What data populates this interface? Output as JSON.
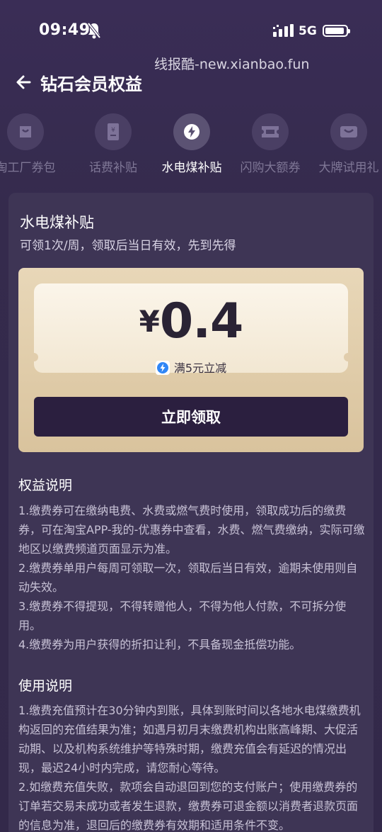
{
  "status": {
    "time": "09:49",
    "network": "5G"
  },
  "watermark": "线报酷-new.xianbao.fun",
  "header": {
    "title": "钻石会员权益"
  },
  "tabs": [
    {
      "label": "淘工厂券包",
      "icon": "bag-icon"
    },
    {
      "label": "话费补贴",
      "icon": "phone-bill-icon"
    },
    {
      "label": "水电煤补贴",
      "icon": "utility-icon",
      "active": true
    },
    {
      "label": "闪购大额券",
      "icon": "ticket-icon"
    },
    {
      "label": "大牌试用礼",
      "icon": "gift-box-icon"
    }
  ],
  "card": {
    "title": "水电煤补贴",
    "subtitle": "可领1次/周，领取后当日有效，先到先得",
    "coupon": {
      "currency": "¥",
      "amount": "0.4",
      "condition": "满5元立减"
    },
    "claim_label": "立即领取",
    "rights": {
      "title": "权益说明",
      "items": [
        "1.缴费券可在缴纳电费、水费或燃气费时使用，领取成功后的缴费券，可在淘宝APP-我的-优惠券中查看，水费、燃气费缴纳，实际可缴地区以缴费频道页面显示为准。",
        "2.缴费券单用户每周可领取一次，领取后当日有效，逾期未使用则自动失效。",
        "3.缴费券不得提现，不得转赠他人，不得为他人付款，不可拆分使用。",
        "4.缴费券为用户获得的折扣让利，不具备现金抵偿功能。"
      ]
    },
    "usage": {
      "title": "使用说明",
      "items": [
        "1.缴费充值预计在30分钟内到账，具体到账时间以各地水电煤缴费机构返回的充值结果为准；如遇月初月末缴费机构出账高峰期、大促活动期、以及机构系统维护等特殊时期，缴费充值会有延迟的情况出现，最迟24小时内完成，请您耐心等待。",
        "2.如缴费充值失败，款项会自动退回到您的支付账户；使用缴费券的订单若交易未成功或者发生退款，缴费券可退金额以消费者退款页面的信息为准，退回后的缴费券有效期和适用条件不变。"
      ]
    }
  },
  "colors": {
    "background": "#352b4d",
    "card": "#3e3555",
    "coupon_gold": "#d9c39d",
    "button_dark": "#2b1f3f"
  }
}
